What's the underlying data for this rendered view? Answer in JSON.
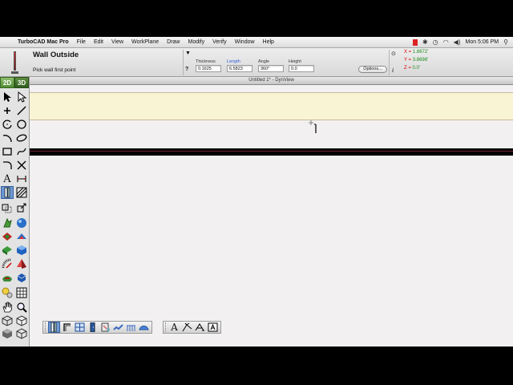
{
  "menubar": {
    "apple_glyph": "",
    "app_name": "TurboCAD Mac Pro",
    "items": [
      "File",
      "Edit",
      "View",
      "WorkPlane",
      "Draw",
      "Modify",
      "Verify",
      "Window",
      "Help"
    ],
    "clock": "Mon 5:06 PM"
  },
  "inspector": {
    "tool_title": "Wall Outside",
    "prompt": "Pick wall first point",
    "fields": [
      {
        "label": "Thickness",
        "value": "0.1625"
      },
      {
        "label": "Length",
        "value": "6.5823"
      },
      {
        "label": "Angle",
        "value": "360°"
      },
      {
        "label": "Height",
        "value": "0.0"
      }
    ],
    "options_label": "Options...",
    "coords": {
      "x_label": "X =",
      "x_value": "1.8672'",
      "y_label": "Y =",
      "y_value": "3.8698'",
      "z_label": "Z =",
      "z_value": "0.0'"
    },
    "help_glyph": "?",
    "dropdown_glyph": "▼",
    "info_glyph": "i"
  },
  "document": {
    "title": "Untitled 1* - DynView"
  },
  "palette": {
    "mode_2d": "2D",
    "mode_3d": "3D",
    "text_tool_glyph": "A"
  },
  "floating_palette": {
    "text_glyph": "A"
  },
  "colors": {
    "accent_selected": "#6f98d4",
    "mode_green": "#4f8c33",
    "wall_fill": "#f9f4d4",
    "coord_label": "#d00000",
    "coord_value": "#1a8a1a"
  }
}
